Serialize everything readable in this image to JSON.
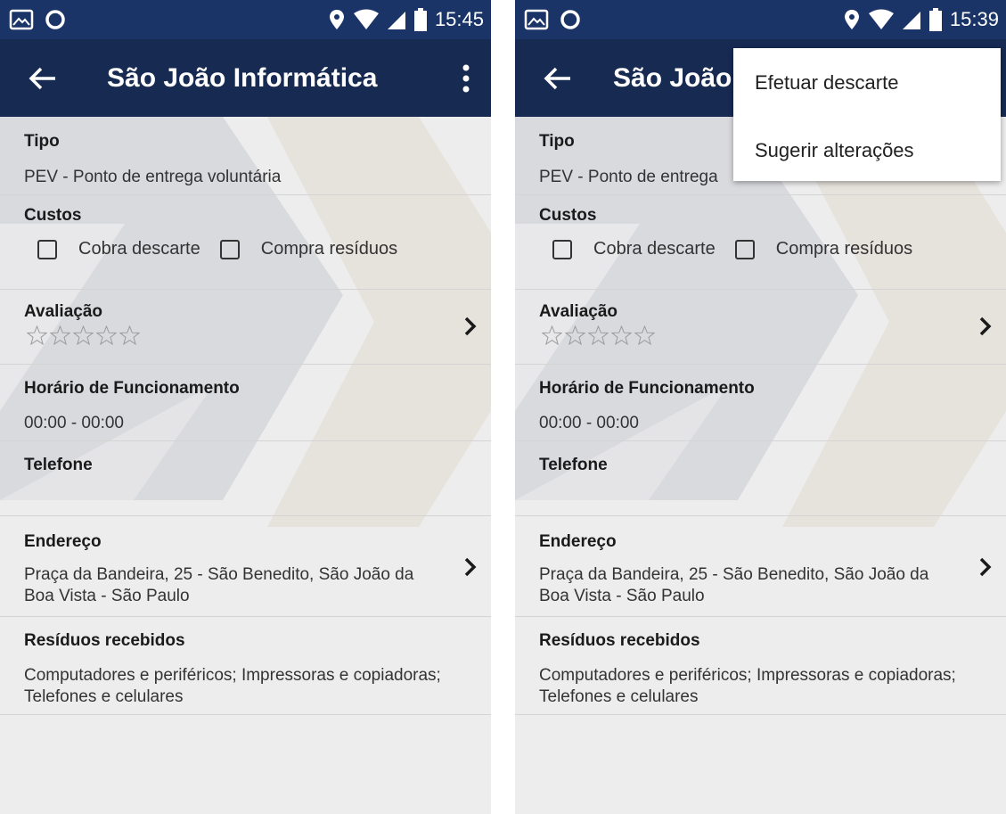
{
  "screens": [
    {
      "status_bar": {
        "time": "15:45"
      },
      "app_bar": {
        "title": "São João Informática"
      },
      "fields": {
        "tipo_label": "Tipo",
        "tipo_value": "PEV - Ponto de entrega voluntária",
        "custos_label": "Custos",
        "cobra_descarte": "Cobra descarte",
        "compra_residuos": "Compra resíduos",
        "avaliacao_label": "Avaliação",
        "horario_label": "Horário de Funcionamento",
        "horario_value": "00:00 - 00:00",
        "telefone_label": "Telefone",
        "endereco_label": "Endereço",
        "endereco_value": "Praça da Bandeira, 25 - São Benedito, São João da Boa Vista - São Paulo",
        "residuos_label": "Resíduos recebidos",
        "residuos_value": "Computadores e periféricos; Impressoras e copiadoras; Telefones e celulares"
      },
      "rating": 0
    },
    {
      "status_bar": {
        "time": "15:39"
      },
      "app_bar": {
        "title": "São João"
      },
      "overflow_menu": {
        "items": [
          "Efetuar descarte",
          "Sugerir alterações"
        ]
      },
      "fields": {
        "tipo_label": "Tipo",
        "tipo_value": "PEV - Ponto de entrega",
        "custos_label": "Custos",
        "cobra_descarte": "Cobra descarte",
        "compra_residuos": "Compra resíduos",
        "avaliacao_label": "Avaliação",
        "horario_label": "Horário de Funcionamento",
        "horario_value": "00:00 - 00:00",
        "telefone_label": "Telefone",
        "endereco_label": "Endereço",
        "endereco_value": "Praça da Bandeira, 25 - São Benedito, São João da Boa Vista - São Paulo",
        "residuos_label": "Resíduos recebidos",
        "residuos_value": "Computadores e periféricos; Impressoras e copiadoras; Telefones e celulares"
      },
      "rating": 0
    }
  ],
  "colors": {
    "status_bar": "#1b3468",
    "app_bar": "#172a52"
  }
}
